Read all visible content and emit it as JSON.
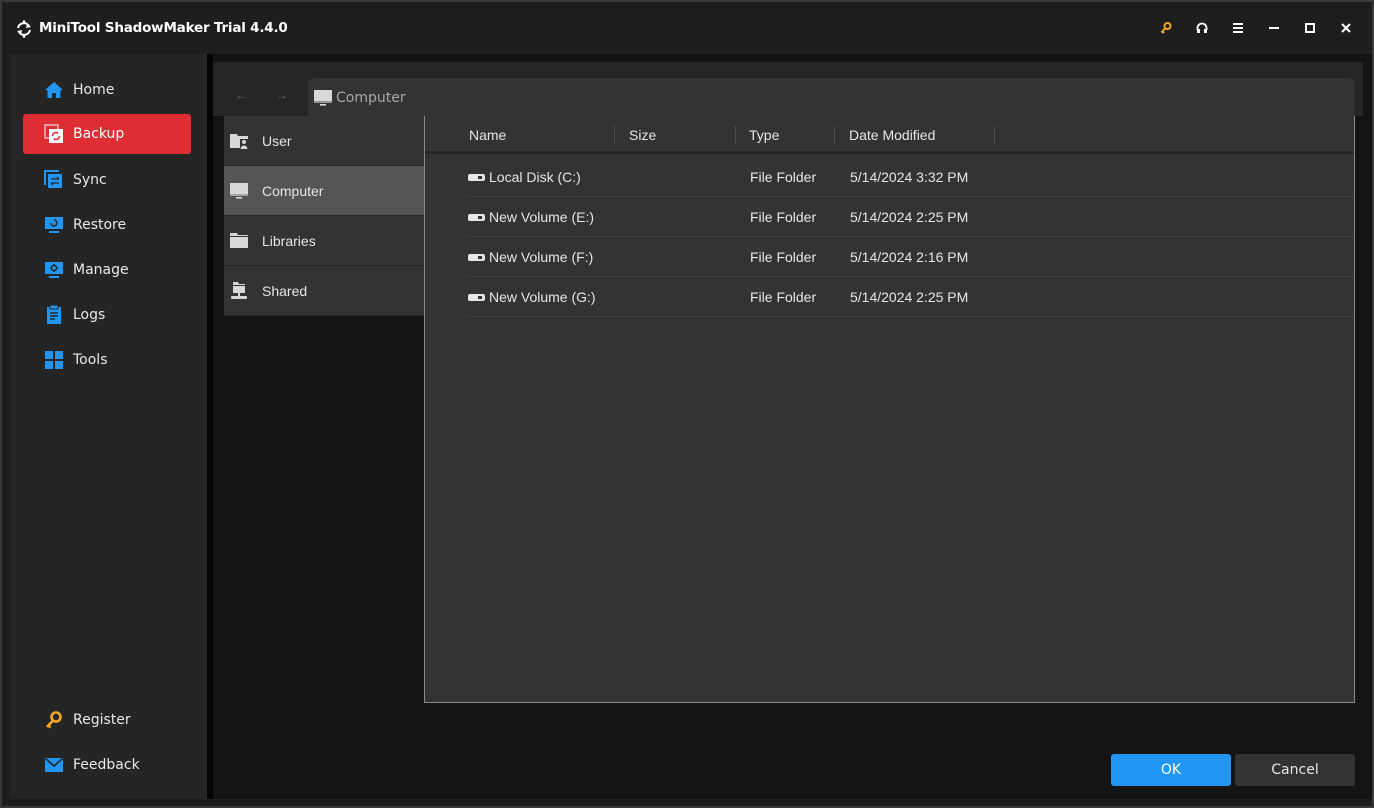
{
  "window": {
    "title": "MiniTool ShadowMaker Trial 4.4.0",
    "controls": [
      "key-icon",
      "headset-icon",
      "menu-icon",
      "minimize-icon",
      "maximize-icon",
      "close-icon"
    ]
  },
  "sidebar": {
    "items": [
      {
        "label": "Home",
        "icon": "home-icon",
        "active": false
      },
      {
        "label": "Backup",
        "icon": "backup-icon",
        "active": true
      },
      {
        "label": "Sync",
        "icon": "sync-icon",
        "active": false
      },
      {
        "label": "Restore",
        "icon": "restore-icon",
        "active": false
      },
      {
        "label": "Manage",
        "icon": "manage-icon",
        "active": false
      },
      {
        "label": "Logs",
        "icon": "logs-icon",
        "active": false
      },
      {
        "label": "Tools",
        "icon": "tools-icon",
        "active": false
      }
    ],
    "bottom": [
      {
        "label": "Register",
        "icon": "key-icon"
      },
      {
        "label": "Feedback",
        "icon": "mail-icon"
      }
    ]
  },
  "browser": {
    "back_label": "←",
    "forward_label": "→",
    "address": "Computer",
    "tree": [
      {
        "label": "User",
        "icon": "user-folder-icon",
        "selected": false
      },
      {
        "label": "Computer",
        "icon": "computer-icon",
        "selected": true
      },
      {
        "label": "Libraries",
        "icon": "folder-icon",
        "selected": false
      },
      {
        "label": "Shared",
        "icon": "shared-icon",
        "selected": false
      }
    ],
    "columns": [
      "Name",
      "Size",
      "Type",
      "Date Modified"
    ],
    "rows": [
      {
        "name": "Local Disk (C:)",
        "size": "",
        "type": "File Folder",
        "modified": "5/14/2024 3:32 PM"
      },
      {
        "name": "New Volume (E:)",
        "size": "",
        "type": "File Folder",
        "modified": "5/14/2024 2:25 PM"
      },
      {
        "name": "New Volume (F:)",
        "size": "",
        "type": "File Folder",
        "modified": "5/14/2024 2:16 PM"
      },
      {
        "name": "New Volume (G:)",
        "size": "",
        "type": "File Folder",
        "modified": "5/14/2024 2:25 PM"
      }
    ]
  },
  "buttons": {
    "ok": "OK",
    "cancel": "Cancel"
  },
  "colors": {
    "accent": "#2196f3",
    "active_nav": "#dc2e33",
    "key_gold": "#f5a623"
  }
}
